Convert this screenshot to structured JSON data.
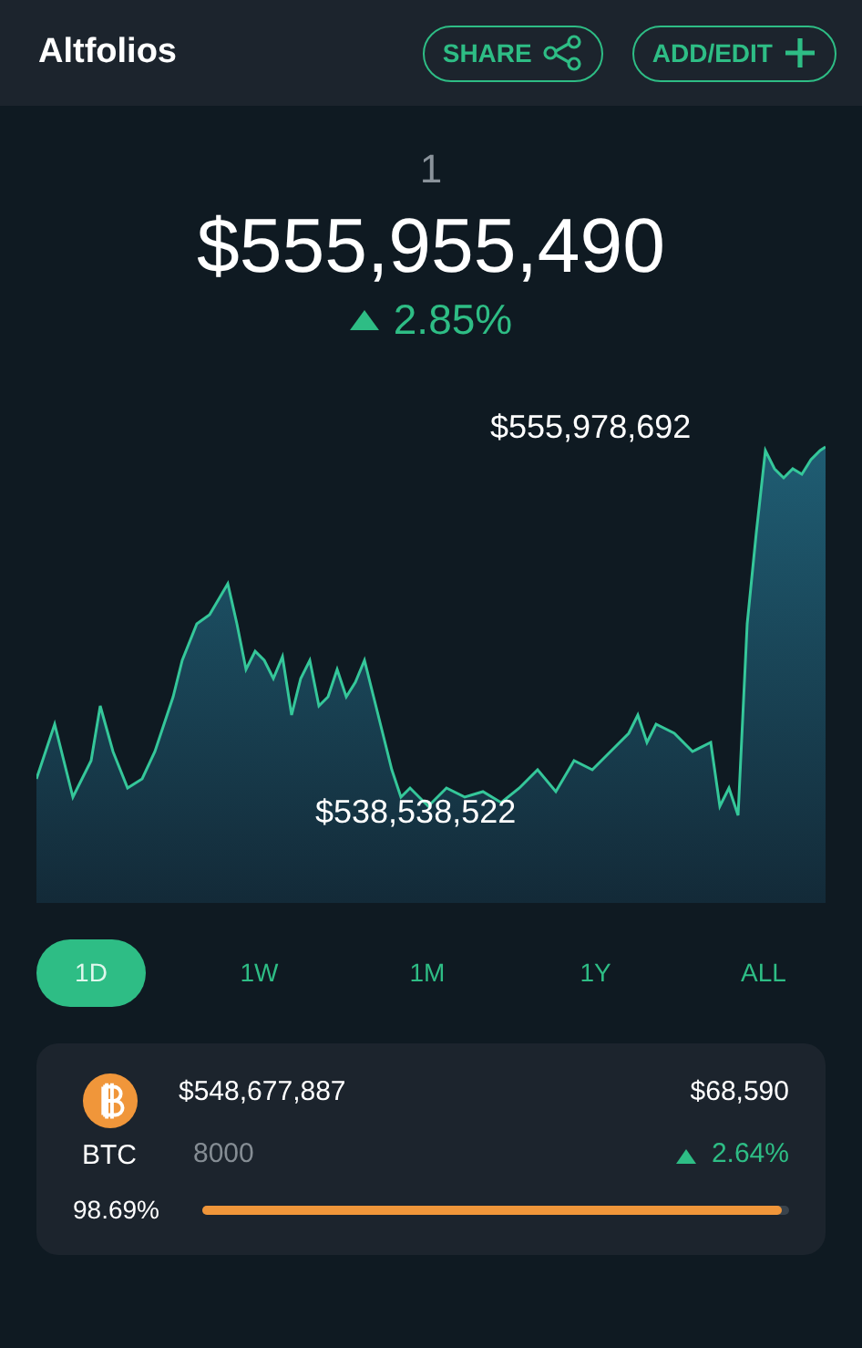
{
  "header": {
    "title": "Altfolios",
    "buttons": [
      {
        "label": "SHARE",
        "kind": "share"
      },
      {
        "label": "ADD/EDIT",
        "kind": "add"
      }
    ]
  },
  "summary": {
    "portfolio": "1",
    "total": "$555,955,490",
    "change": "2.85%"
  },
  "chart": {
    "high_label": "$555,978,692",
    "low_label": "$538,538,522"
  },
  "ranges": [
    {
      "label": "1D",
      "selected": true
    },
    {
      "label": "1W",
      "selected": false
    },
    {
      "label": "1M",
      "selected": false
    },
    {
      "label": "1Y",
      "selected": false
    },
    {
      "label": "ALL",
      "selected": false
    }
  ],
  "holdings": [
    {
      "symbol": "BTC",
      "value": "$548,677,887",
      "amount": "8000",
      "price": "$68,590",
      "change": "2.64%",
      "share": "98.69%",
      "level": 0.9869,
      "color": "#f0963a"
    }
  ]
}
